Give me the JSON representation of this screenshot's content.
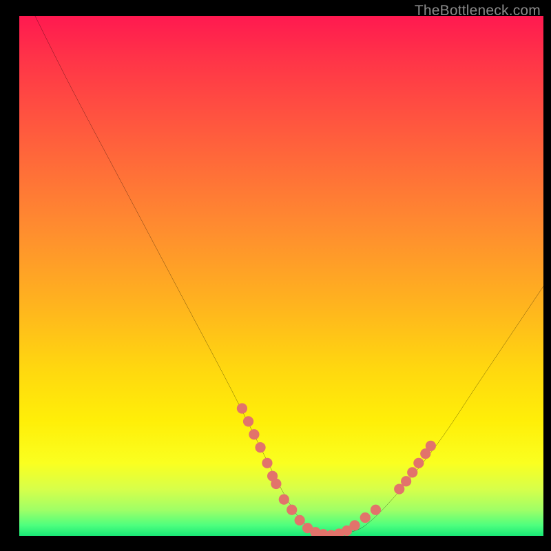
{
  "watermark": "TheBottleneck.com",
  "chart_data": {
    "type": "line",
    "title": "",
    "xlabel": "",
    "ylabel": "",
    "xlim": [
      0,
      100
    ],
    "ylim": [
      0,
      100
    ],
    "grid": false,
    "legend": false,
    "series": [
      {
        "name": "bottleneck-curve",
        "x": [
          3,
          10,
          20,
          30,
          40,
          47,
          50,
          53,
          56,
          59,
          62,
          66,
          72,
          80,
          88,
          96,
          100
        ],
        "y": [
          100,
          86,
          67,
          48,
          29,
          15,
          9,
          4,
          1,
          0,
          0.5,
          2,
          8,
          18,
          30,
          42,
          48
        ]
      }
    ],
    "markers": {
      "name": "highlight-dots",
      "color": "#e2736b",
      "radius": 1.0,
      "points_xy": [
        [
          42.5,
          24.5
        ],
        [
          43.7,
          22.0
        ],
        [
          44.8,
          19.5
        ],
        [
          46.0,
          17.0
        ],
        [
          47.3,
          14.0
        ],
        [
          48.3,
          11.5
        ],
        [
          49.0,
          10.0
        ],
        [
          50.5,
          7.0
        ],
        [
          52.0,
          5.0
        ],
        [
          53.5,
          3.0
        ],
        [
          55.0,
          1.5
        ],
        [
          56.5,
          0.7
        ],
        [
          58.0,
          0.3
        ],
        [
          59.5,
          0.1
        ],
        [
          61.0,
          0.4
        ],
        [
          62.5,
          1.0
        ],
        [
          64.0,
          2.0
        ],
        [
          66.0,
          3.5
        ],
        [
          68.0,
          5.0
        ],
        [
          72.5,
          9.0
        ],
        [
          73.8,
          10.5
        ],
        [
          75.0,
          12.2
        ],
        [
          76.2,
          14.0
        ],
        [
          77.5,
          15.8
        ],
        [
          78.5,
          17.3
        ]
      ]
    },
    "background_gradient_stops": [
      {
        "pos": 0.0,
        "color": "#ff1950"
      },
      {
        "pos": 0.4,
        "color": "#ff8a30"
      },
      {
        "pos": 0.78,
        "color": "#ffef08"
      },
      {
        "pos": 1.0,
        "color": "#19e876"
      }
    ]
  }
}
